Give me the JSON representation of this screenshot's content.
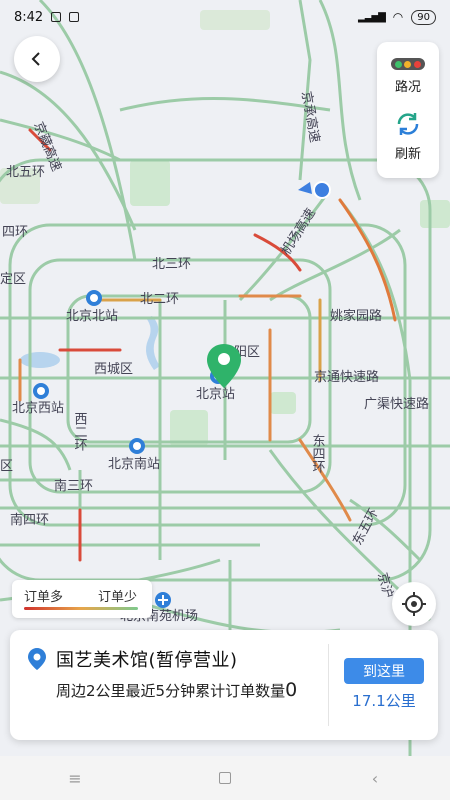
{
  "status": {
    "time": "8:42",
    "signal": "📶",
    "wifi": "wifi",
    "battery": "90"
  },
  "side_panel": {
    "traffic_label": "路况",
    "refresh_label": "刷新",
    "traffic_colors": [
      "#3ec16b",
      "#f2b12a",
      "#e8413b"
    ]
  },
  "legend": {
    "left_label": "订单多",
    "right_label": "订单少"
  },
  "card": {
    "title": "国艺美术馆(暂停营业)",
    "desc_text": "周边2公里最近5分钟累计订单数量",
    "order_count": "0",
    "go_button": "到这里",
    "distance": "17.1公里"
  },
  "map_labels": {
    "road_jingzang": "京藏高速",
    "road_jingcheng": "京承高速",
    "road_n5": "北五环",
    "road_4w": "四环",
    "road_jichang": "机场高速",
    "road_n3": "北三环",
    "road_n2": "北二环",
    "road_yaojia": "姚家园路",
    "station_north": "北京北站",
    "district_xicheng": "西城区",
    "district_chaoyang": "阳区",
    "station_beijing": "北京站",
    "road_jingtong": "京通快速路",
    "road_guangqu": "广渠快速路",
    "station_west": "北京西站",
    "road_w2": "西二环",
    "road_e4": "东四环",
    "station_south": "北京南站",
    "road_s3": "南三环",
    "road_s4": "南四环",
    "road_e5": "东五环",
    "airport_nanyuan": "北京南苑机场",
    "road_yongding": "定区",
    "road_jinghu": "京沪",
    "district_left": "区"
  },
  "nav": {
    "menu": "≡",
    "back": "‹"
  }
}
